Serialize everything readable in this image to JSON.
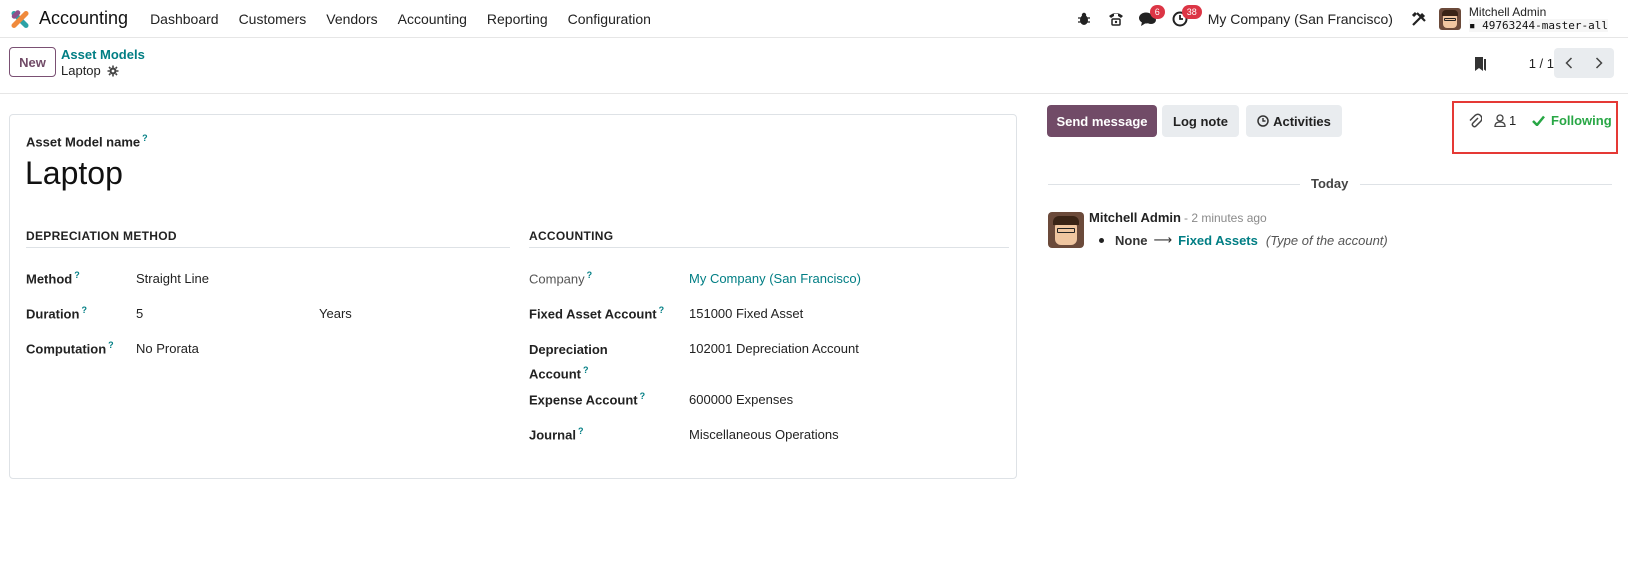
{
  "navbar": {
    "app_name": "Accounting",
    "menu": [
      "Dashboard",
      "Customers",
      "Vendors",
      "Accounting",
      "Reporting",
      "Configuration"
    ],
    "messages_badge": "6",
    "activities_badge": "38",
    "company": "My Company (San Francisco)",
    "user_name": "Mitchell Admin",
    "database": "49763244-master-all"
  },
  "control": {
    "new_label": "New",
    "breadcrumb_parent": "Asset Models",
    "breadcrumb_current": "Laptop",
    "pager": "1 / 1"
  },
  "form": {
    "name_label": "Asset Model name",
    "name_value": "Laptop",
    "depreciation": {
      "heading": "DEPRECIATION METHOD",
      "method_label": "Method",
      "method_value": "Straight Line",
      "duration_label": "Duration",
      "duration_value": "5",
      "duration_unit": "Years",
      "computation_label": "Computation",
      "computation_value": "No Prorata"
    },
    "accounting": {
      "heading": "ACCOUNTING",
      "company_label": "Company",
      "company_value": "My Company (San Francisco)",
      "fixed_asset_label": "Fixed Asset Account",
      "fixed_asset_value": "151000 Fixed Asset",
      "depreciation_label_1": "Depreciation",
      "depreciation_label_2": "Account",
      "depreciation_value": "102001 Depreciation Account",
      "expense_label": "Expense Account",
      "expense_value": "600000 Expenses",
      "journal_label": "Journal",
      "journal_value": "Miscellaneous Operations"
    }
  },
  "chatter": {
    "send_message": "Send message",
    "log_note": "Log note",
    "activities": "Activities",
    "followers_count": "1",
    "following": "Following",
    "date_separator": "Today",
    "message": {
      "author": "Mitchell Admin",
      "time": "- 2 minutes ago",
      "old_value": "None",
      "arrow": "⟶",
      "new_value": "Fixed Assets",
      "field": "(Type of the account)"
    }
  },
  "help_mark": "?"
}
